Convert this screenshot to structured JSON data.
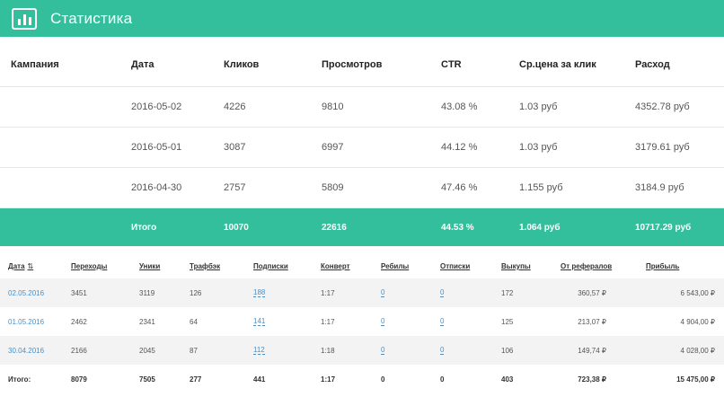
{
  "header": {
    "title": "Статистика",
    "icon": "bar-chart-icon",
    "color": "#34bf9c"
  },
  "summary_table": {
    "columns": [
      "Кампания",
      "Дата",
      "Кликов",
      "Просмотров",
      "CTR",
      "Ср.цена за клик",
      "Расход"
    ],
    "rows": [
      [
        "",
        "2016-05-02",
        "4226",
        "9810",
        "43.08 %",
        "1.03 руб",
        "4352.78 руб"
      ],
      [
        "",
        "2016-05-01",
        "3087",
        "6997",
        "44.12 %",
        "1.03 руб",
        "3179.61 руб"
      ],
      [
        "",
        "2016-04-30",
        "2757",
        "5809",
        "47.46 %",
        "1.155 руб",
        "3184.9 руб"
      ]
    ],
    "total": [
      "",
      "Итого",
      "10070",
      "22616",
      "44.53 %",
      "1.064 руб",
      "10717.29 руб"
    ]
  },
  "detail_table": {
    "columns": [
      "Дата",
      "Переходы",
      "Уники",
      "Трафбэк",
      "Подписки",
      "Конверт",
      "Ребилы",
      "Отписки",
      "Выкупы",
      "От рефералов",
      "Прибыль"
    ],
    "sort_icon": "sort-icon",
    "rows": [
      [
        "02.05.2016",
        "3451",
        "3119",
        "126",
        "188",
        "1:17",
        "0",
        "0",
        "172",
        "360,57 ₽",
        "6 543,00 ₽"
      ],
      [
        "01.05.2016",
        "2462",
        "2341",
        "64",
        "141",
        "1:17",
        "0",
        "0",
        "125",
        "213,07 ₽",
        "4 904,00 ₽"
      ],
      [
        "30.04.2016",
        "2166",
        "2045",
        "87",
        "112",
        "1:18",
        "0",
        "0",
        "106",
        "149,74 ₽",
        "4 028,00 ₽"
      ]
    ],
    "total": [
      "Итого:",
      "8079",
      "7505",
      "277",
      "441",
      "1:17",
      "0",
      "0",
      "403",
      "723,38 ₽",
      "15 475,00 ₽"
    ]
  }
}
